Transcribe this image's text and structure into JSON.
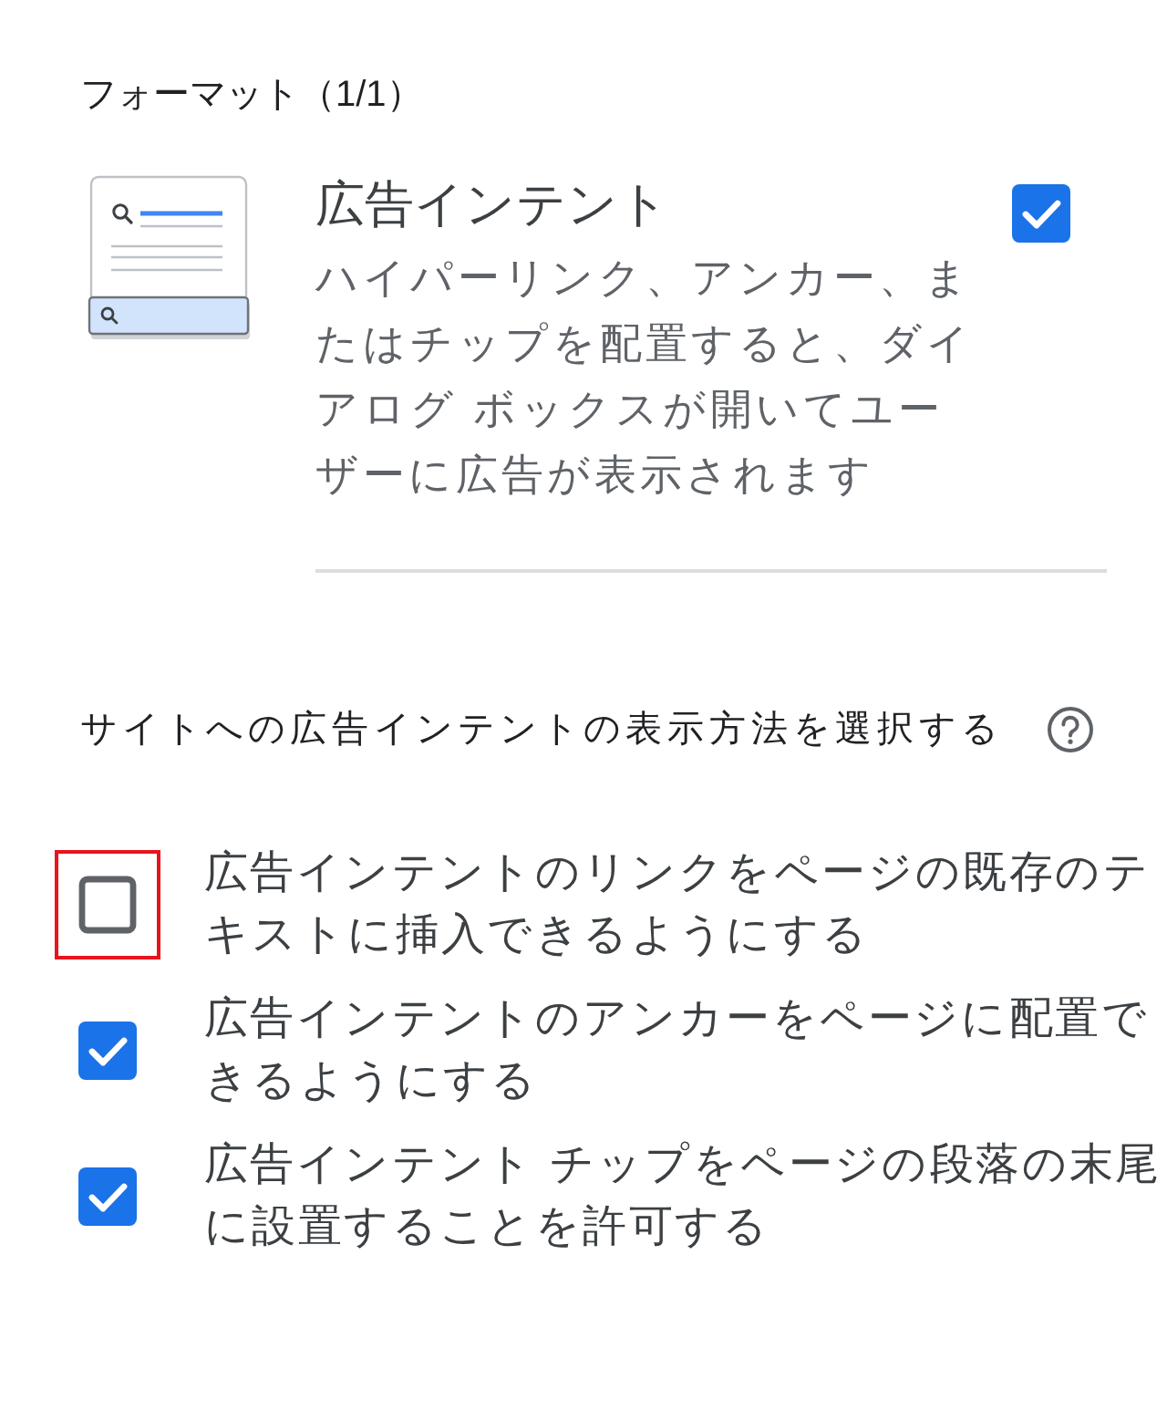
{
  "section_heading": "フォーマット（1/1）",
  "format": {
    "title": "広告インテント",
    "description": "ハイパーリンク、アンカー、またはチップを配置すると、ダイアログ ボックスが開いてユーザーに広告が表示されます",
    "checked": true
  },
  "display_method": {
    "heading": "サイトへの広告インテントの表示方法を選択する",
    "options": [
      {
        "label": "広告インテントのリンクをページの既存のテキストに挿入できるようにする",
        "checked": false,
        "highlighted": true
      },
      {
        "label": "広告インテントのアンカーをページに配置できるようにする",
        "checked": true,
        "highlighted": false
      },
      {
        "label": "広告インテント チップをページの段落の末尾に設置することを許可する",
        "checked": true,
        "highlighted": false
      }
    ]
  }
}
